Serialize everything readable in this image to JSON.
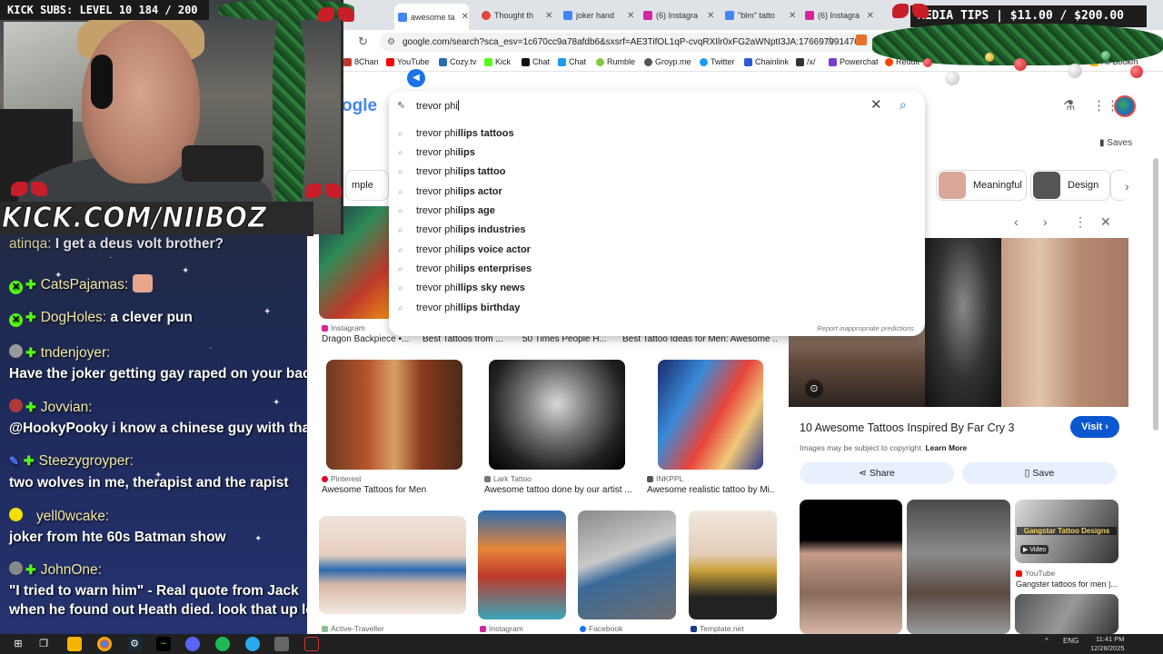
{
  "browser": {
    "tabs": [
      {
        "title": "awesome ta",
        "active": true,
        "color": "#4285f4"
      },
      {
        "title": "Thought th",
        "color": "#e0443b"
      },
      {
        "title": "joker hand",
        "color": "#4285f4"
      },
      {
        "title": "(6) Instagra",
        "color": "#d6249f"
      },
      {
        "title": "\"blm\" tatto",
        "color": "#4285f4"
      },
      {
        "title": "(6) Instagra",
        "color": "#d6249f"
      }
    ],
    "url": "google.com/search?sca_esv=1c670cc9a78afdb6&sxsrf=AE3TifOL1qP-cvqRXIlr0xFG2aWNptI3JA:176697991476...",
    "bookmarks": [
      {
        "label": "8Chan",
        "color": "#c0392b"
      },
      {
        "label": "YouTube",
        "color": "#ff0000"
      },
      {
        "label": "Cozy.tv",
        "color": "#2b6cb0"
      },
      {
        "label": "Kick",
        "color": "#53fc18"
      },
      {
        "label": "Chat",
        "color": "#111111"
      },
      {
        "label": "Chat",
        "color": "#1d9bf0"
      },
      {
        "label": "Rumble",
        "color": "#85c742"
      },
      {
        "label": "Groyp.me",
        "color": "#555555"
      },
      {
        "label": "Twitter",
        "color": "#1d9bf0"
      },
      {
        "label": "Chainlink",
        "color": "#2a5ada"
      },
      {
        "label": "/x/",
        "color": "#333333"
      },
      {
        "label": "Powerchat",
        "color": "#7a3ccf"
      },
      {
        "label": "Reddit",
        "color": "#ff4500"
      },
      {
        "label": "All Bookm",
        "color": "#f4b400"
      }
    ]
  },
  "search": {
    "query": "trevor phi",
    "suggestions": [
      {
        "prefix": "trevor phi",
        "bold": "llips tattoos"
      },
      {
        "prefix": "trevor phi",
        "bold": "lips"
      },
      {
        "prefix": "trevor phi",
        "bold": "lips tattoo"
      },
      {
        "prefix": "trevor phi",
        "bold": "lips actor"
      },
      {
        "prefix": "trevor phi",
        "bold": "lips age"
      },
      {
        "prefix": "trevor phi",
        "bold": "lips industries"
      },
      {
        "prefix": "trevor phi",
        "bold": "lips voice actor"
      },
      {
        "prefix": "trevor phi",
        "bold": "lips enterprises"
      },
      {
        "prefix": "trevor phi",
        "bold": "llips sky news"
      },
      {
        "prefix": "trevor phi",
        "bold": "llips birthday"
      }
    ],
    "report": "Report inappropriate predictions"
  },
  "google": {
    "logo": "ogle",
    "saves": "Saves",
    "chips": [
      "mple",
      "Meaningful",
      "Design"
    ]
  },
  "results": {
    "row1": [
      {
        "source": "Instagram",
        "title": "Dragon Backpiece •..."
      },
      {
        "source": "",
        "title": "Best Tattoos from ..."
      },
      {
        "source": "",
        "title": "50 Times People H..."
      },
      {
        "source": "",
        "title": "Best Tattoo Ideas for Men: Awesome ..."
      }
    ],
    "row2": [
      {
        "source": "Pinterest",
        "title": "Awesome Tattoos for Men"
      },
      {
        "source": "Lark Tattoo",
        "title": "Awesome tattoo done by our artist ..."
      },
      {
        "source": "INKPPL",
        "title": "Awesome realistic tattoo by Mi..."
      }
    ],
    "row3": [
      {
        "source": "Active-Traveller"
      },
      {
        "source": "Instagram"
      },
      {
        "source": "Facebook"
      },
      {
        "source": "Template.net"
      }
    ]
  },
  "panel": {
    "title": "10 Awesome Tattoos Inspired By Far Cry 3",
    "visit": "Visit",
    "copyright": "Images may be subject to copyright.",
    "learn_more": "Learn More",
    "share": "Share",
    "save": "Save",
    "related": [
      {
        "source": "",
        "title": ""
      },
      {
        "source": "",
        "title": ""
      },
      {
        "source": "YouTube",
        "title": "Gangster tattoos for men |...",
        "badge": "Video",
        "thumb_text": "Gangstar Tattoo Designs"
      }
    ]
  },
  "overlay": {
    "kick_subs": "KICK SUBS: LEVEL 10 184 / 200",
    "media_tips": "MEDIA TIPS | $11.00 / $200.00",
    "banner": "KICK.COM/NIIBOZ"
  },
  "chat": [
    {
      "user": "atinqa:",
      "text": "I get a deus volt brother?",
      "badge": "none"
    },
    {
      "user": "CatsPajamas:",
      "text": "",
      "badge": "kick",
      "emote": true
    },
    {
      "user": "DogHoles:",
      "text": "a clever pun",
      "badge": "kick"
    },
    {
      "user": "tndenjoyer:",
      "text": "Have the joker getting gay raped on your back",
      "badge": "avatar"
    },
    {
      "user": "Jovvian:",
      "text": "@HookyPooky i know a chinese guy with that",
      "badge": "avatar"
    },
    {
      "user": "Steezygroyper:",
      "text": "two wolves in me, therapist and the rapist",
      "badge": "blue"
    },
    {
      "user": "yell0wcake:",
      "text": "joker from hte 60s Batman show",
      "badge": "yellow"
    },
    {
      "user": "JohnOne:",
      "text": "\"I tried to warn him\" - Real quote from Jack",
      "text2": "when he found out Heath died. look that up lol",
      "badge": "avatar"
    }
  ],
  "taskbar": {
    "lang": "ENG",
    "time": "11:41 PM",
    "date": "12/28/2025"
  }
}
